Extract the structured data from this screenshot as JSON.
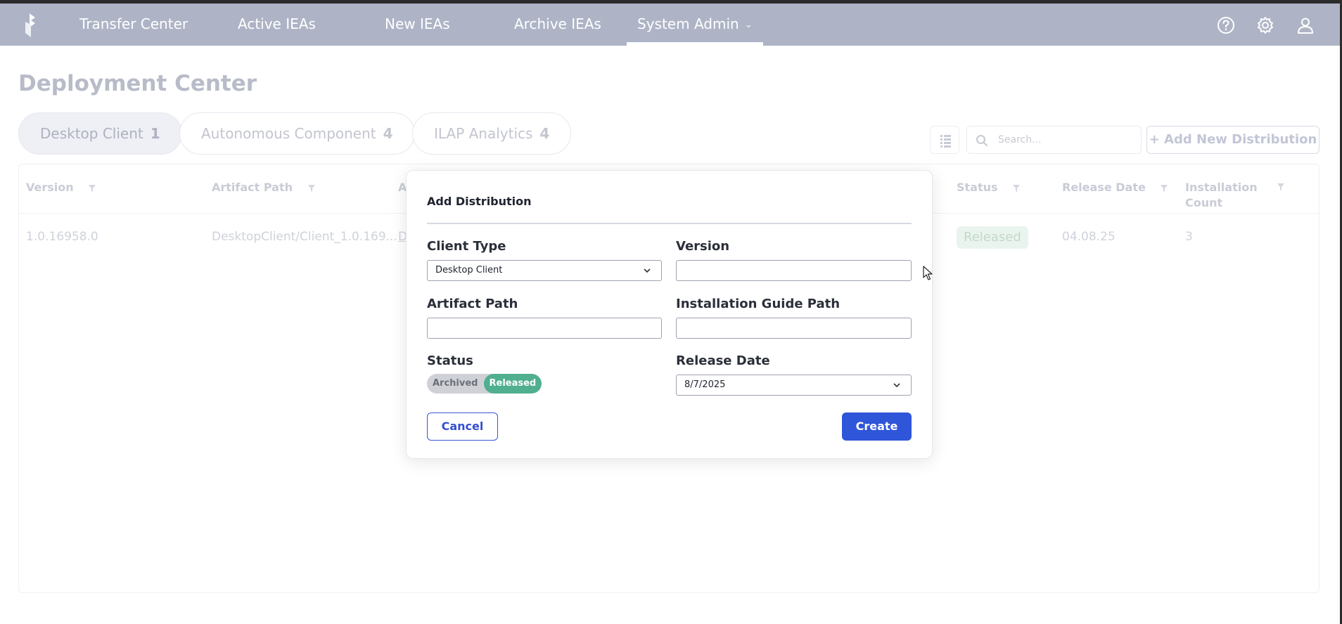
{
  "nav": {
    "items": [
      {
        "label": "Transfer Center"
      },
      {
        "label": "Active IEAs"
      },
      {
        "label": "New IEAs"
      },
      {
        "label": "Archive IEAs"
      },
      {
        "label": "System Admin"
      }
    ]
  },
  "page": {
    "title": "Deployment Center",
    "tabs": [
      {
        "label": "Desktop Client",
        "count": "1"
      },
      {
        "label": "Autonomous Component",
        "count": "4"
      },
      {
        "label": "ILAP Analytics",
        "count": "4"
      }
    ],
    "search_placeholder": "Search...",
    "add_button": "+ Add New Distribution"
  },
  "table": {
    "headers": [
      "Version",
      "Artifact Path",
      "A",
      "Status",
      "Release Date",
      "Installation\nCount"
    ],
    "rows": [
      {
        "version": "1.0.16958.0",
        "artifact_path": "DesktopClient/Client_1.0.169...",
        "col3": "D",
        "status": "Released",
        "release_date": "04.08.25",
        "installation_count": "3"
      }
    ]
  },
  "modal": {
    "title": "Add Distribution",
    "client_type_label": "Client Type",
    "client_type_value": "Desktop Client",
    "version_label": "Version",
    "version_value": "",
    "artifact_path_label": "Artifact Path",
    "artifact_path_value": "",
    "installation_guide_label": "Installation Guide Path",
    "installation_guide_value": "",
    "status_label": "Status",
    "status_options": [
      "Archived",
      "Released"
    ],
    "release_date_label": "Release Date",
    "release_date_value": "8/7/2025",
    "cancel_label": "Cancel",
    "create_label": "Create"
  },
  "icons": {
    "logo": "app-logo",
    "help": "help-icon",
    "settings": "gear-icon",
    "user": "user-icon",
    "grid": "columns-icon",
    "search": "search-icon",
    "filter": "filter-icon",
    "chevron": "chevron-down-icon"
  },
  "colors": {
    "nav_bg": "#aeb4c6",
    "primary": "#2f55d9",
    "released": "#4faf8e"
  }
}
